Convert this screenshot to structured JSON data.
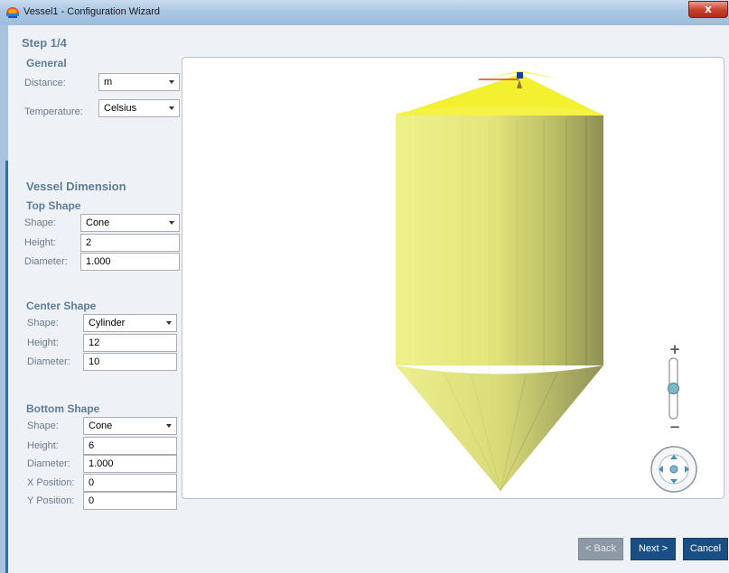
{
  "window": {
    "title": "Vessel1 - Configuration Wizard",
    "close_label": "x"
  },
  "step": "Step 1/4",
  "general": {
    "heading": "General",
    "distance_label": "Distance:",
    "distance_value": "m",
    "temperature_label": "Temperature:",
    "temperature_value": "Celsius"
  },
  "vessel_dimension": {
    "heading": "Vessel Dimension"
  },
  "top_shape": {
    "heading": "Top Shape",
    "shape_label": "Shape:",
    "shape_value": "Cone",
    "height_label": "Height:",
    "height_value": "2",
    "diameter_label": "Diameter:",
    "diameter_value": "1.000"
  },
  "center_shape": {
    "heading": "Center Shape",
    "shape_label": "Shape:",
    "shape_value": "Cylinder",
    "height_label": "Height:",
    "height_value": "12",
    "diameter_label": "Diameter:",
    "diameter_value": "10"
  },
  "bottom_shape": {
    "heading": "Bottom Shape",
    "shape_label": "Shape:",
    "shape_value": "Cone",
    "height_label": "Height:",
    "height_value": "6",
    "diameter_label": "Diameter:",
    "diameter_value": "1.000",
    "xpos_label": "X Position:",
    "xpos_value": "0",
    "ypos_label": "Y Position:",
    "ypos_value": "0"
  },
  "viewer": {
    "zoom_plus": "+",
    "zoom_minus": "−",
    "zoom_level": 0.5
  },
  "buttons": {
    "back": "< Back",
    "next": "Next >",
    "cancel": "Cancel"
  },
  "colors": {
    "accent": "#1a4f86",
    "heading": "#5f7d98",
    "vessel": "#eef08a"
  }
}
